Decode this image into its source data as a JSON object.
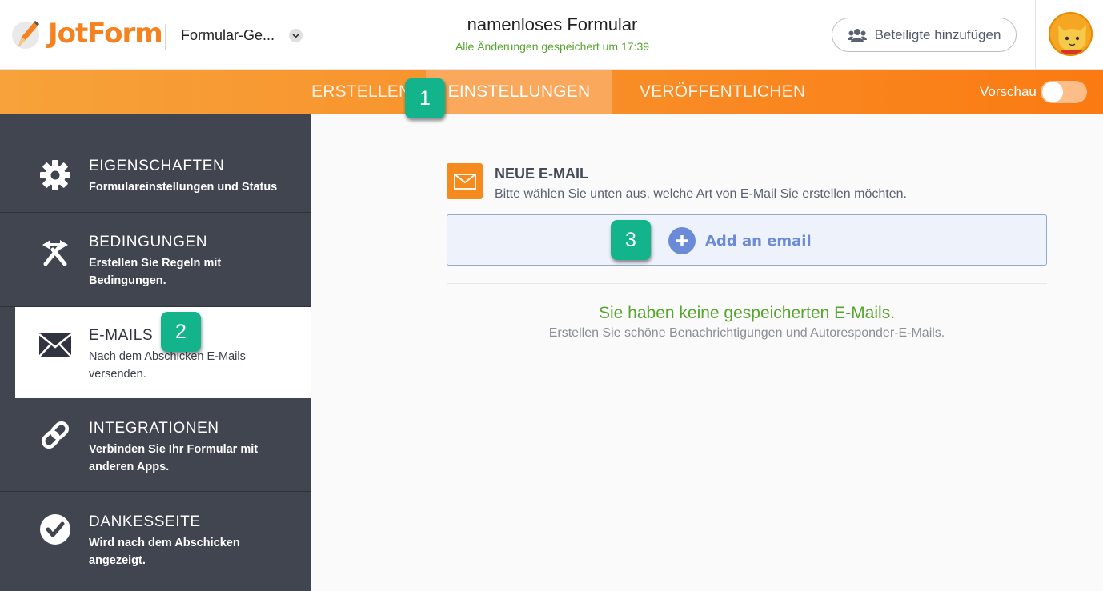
{
  "header": {
    "logo_text": "JotForm",
    "form_dropdown_label": "Formular-Ge...",
    "form_title": "namenloses Formular",
    "save_status": "Alle Änderungen gespeichert um 17:39",
    "add_participants_label": "Beteiligte hinzufügen"
  },
  "nav": {
    "tabs": [
      {
        "label": "ERSTELLEN",
        "active": false
      },
      {
        "label": "EINSTELLUNGEN",
        "active": true
      },
      {
        "label": "VERÖFFENTLICHEN",
        "active": false
      }
    ],
    "preview_label": "Vorschau",
    "preview_on": false
  },
  "badges": [
    "1",
    "2",
    "3"
  ],
  "sidebar": {
    "items": [
      {
        "title": "EIGENSCHAFTEN",
        "desc": "Formulareinstellungen und Status",
        "icon": "gear-icon"
      },
      {
        "title": "BEDINGUNGEN",
        "desc": "Erstellen Sie Regeln mit Bedingungen.",
        "icon": "conditions-icon"
      },
      {
        "title": "E-MAILS",
        "desc": "Nach dem Abschicken E-Mails versenden.",
        "icon": "envelope-icon",
        "active": true
      },
      {
        "title": "INTEGRATIONEN",
        "desc": "Verbinden Sie Ihr Formular mit anderen Apps.",
        "icon": "link-icon"
      },
      {
        "title": "DANKESSEITE",
        "desc": "Wird nach dem Abschicken angezeigt.",
        "icon": "check-circle-icon"
      }
    ]
  },
  "main": {
    "new_email_title": "NEUE E-MAIL",
    "new_email_desc": "Bitte wählen Sie unten aus, welche Art von E-Mail Sie erstellen möchten.",
    "add_email_label": "Add an email",
    "empty_title": "Sie haben keine gespeicherten E-Mails.",
    "empty_desc": "Erstellen Sie schöne Benachrichtigungen und Autoresponder-E-Mails."
  },
  "colors": {
    "accent_orange": "#f58a1f",
    "sidebar_bg": "#40454f",
    "success_green": "#55a52e",
    "badge_teal": "#13b38c",
    "add_email_blue": "#6b8ad7"
  }
}
